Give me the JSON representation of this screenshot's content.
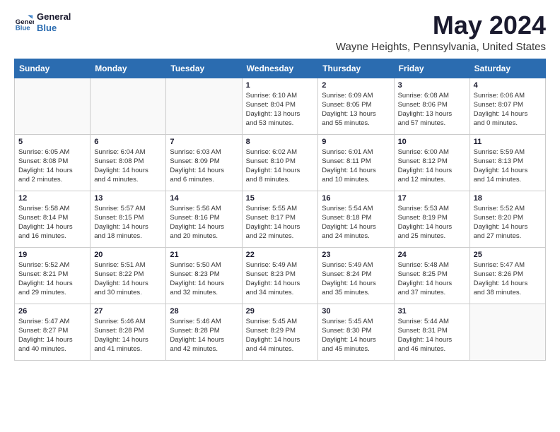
{
  "logo": {
    "line1": "General",
    "line2": "Blue"
  },
  "title": "May 2024",
  "subtitle": "Wayne Heights, Pennsylvania, United States",
  "days_header": [
    "Sunday",
    "Monday",
    "Tuesday",
    "Wednesday",
    "Thursday",
    "Friday",
    "Saturday"
  ],
  "weeks": [
    [
      {
        "day": "",
        "info": ""
      },
      {
        "day": "",
        "info": ""
      },
      {
        "day": "",
        "info": ""
      },
      {
        "day": "1",
        "info": "Sunrise: 6:10 AM\nSunset: 8:04 PM\nDaylight: 13 hours\nand 53 minutes."
      },
      {
        "day": "2",
        "info": "Sunrise: 6:09 AM\nSunset: 8:05 PM\nDaylight: 13 hours\nand 55 minutes."
      },
      {
        "day": "3",
        "info": "Sunrise: 6:08 AM\nSunset: 8:06 PM\nDaylight: 13 hours\nand 57 minutes."
      },
      {
        "day": "4",
        "info": "Sunrise: 6:06 AM\nSunset: 8:07 PM\nDaylight: 14 hours\nand 0 minutes."
      }
    ],
    [
      {
        "day": "5",
        "info": "Sunrise: 6:05 AM\nSunset: 8:08 PM\nDaylight: 14 hours\nand 2 minutes."
      },
      {
        "day": "6",
        "info": "Sunrise: 6:04 AM\nSunset: 8:08 PM\nDaylight: 14 hours\nand 4 minutes."
      },
      {
        "day": "7",
        "info": "Sunrise: 6:03 AM\nSunset: 8:09 PM\nDaylight: 14 hours\nand 6 minutes."
      },
      {
        "day": "8",
        "info": "Sunrise: 6:02 AM\nSunset: 8:10 PM\nDaylight: 14 hours\nand 8 minutes."
      },
      {
        "day": "9",
        "info": "Sunrise: 6:01 AM\nSunset: 8:11 PM\nDaylight: 14 hours\nand 10 minutes."
      },
      {
        "day": "10",
        "info": "Sunrise: 6:00 AM\nSunset: 8:12 PM\nDaylight: 14 hours\nand 12 minutes."
      },
      {
        "day": "11",
        "info": "Sunrise: 5:59 AM\nSunset: 8:13 PM\nDaylight: 14 hours\nand 14 minutes."
      }
    ],
    [
      {
        "day": "12",
        "info": "Sunrise: 5:58 AM\nSunset: 8:14 PM\nDaylight: 14 hours\nand 16 minutes."
      },
      {
        "day": "13",
        "info": "Sunrise: 5:57 AM\nSunset: 8:15 PM\nDaylight: 14 hours\nand 18 minutes."
      },
      {
        "day": "14",
        "info": "Sunrise: 5:56 AM\nSunset: 8:16 PM\nDaylight: 14 hours\nand 20 minutes."
      },
      {
        "day": "15",
        "info": "Sunrise: 5:55 AM\nSunset: 8:17 PM\nDaylight: 14 hours\nand 22 minutes."
      },
      {
        "day": "16",
        "info": "Sunrise: 5:54 AM\nSunset: 8:18 PM\nDaylight: 14 hours\nand 24 minutes."
      },
      {
        "day": "17",
        "info": "Sunrise: 5:53 AM\nSunset: 8:19 PM\nDaylight: 14 hours\nand 25 minutes."
      },
      {
        "day": "18",
        "info": "Sunrise: 5:52 AM\nSunset: 8:20 PM\nDaylight: 14 hours\nand 27 minutes."
      }
    ],
    [
      {
        "day": "19",
        "info": "Sunrise: 5:52 AM\nSunset: 8:21 PM\nDaylight: 14 hours\nand 29 minutes."
      },
      {
        "day": "20",
        "info": "Sunrise: 5:51 AM\nSunset: 8:22 PM\nDaylight: 14 hours\nand 30 minutes."
      },
      {
        "day": "21",
        "info": "Sunrise: 5:50 AM\nSunset: 8:23 PM\nDaylight: 14 hours\nand 32 minutes."
      },
      {
        "day": "22",
        "info": "Sunrise: 5:49 AM\nSunset: 8:23 PM\nDaylight: 14 hours\nand 34 minutes."
      },
      {
        "day": "23",
        "info": "Sunrise: 5:49 AM\nSunset: 8:24 PM\nDaylight: 14 hours\nand 35 minutes."
      },
      {
        "day": "24",
        "info": "Sunrise: 5:48 AM\nSunset: 8:25 PM\nDaylight: 14 hours\nand 37 minutes."
      },
      {
        "day": "25",
        "info": "Sunrise: 5:47 AM\nSunset: 8:26 PM\nDaylight: 14 hours\nand 38 minutes."
      }
    ],
    [
      {
        "day": "26",
        "info": "Sunrise: 5:47 AM\nSunset: 8:27 PM\nDaylight: 14 hours\nand 40 minutes."
      },
      {
        "day": "27",
        "info": "Sunrise: 5:46 AM\nSunset: 8:28 PM\nDaylight: 14 hours\nand 41 minutes."
      },
      {
        "day": "28",
        "info": "Sunrise: 5:46 AM\nSunset: 8:28 PM\nDaylight: 14 hours\nand 42 minutes."
      },
      {
        "day": "29",
        "info": "Sunrise: 5:45 AM\nSunset: 8:29 PM\nDaylight: 14 hours\nand 44 minutes."
      },
      {
        "day": "30",
        "info": "Sunrise: 5:45 AM\nSunset: 8:30 PM\nDaylight: 14 hours\nand 45 minutes."
      },
      {
        "day": "31",
        "info": "Sunrise: 5:44 AM\nSunset: 8:31 PM\nDaylight: 14 hours\nand 46 minutes."
      },
      {
        "day": "",
        "info": ""
      }
    ]
  ]
}
